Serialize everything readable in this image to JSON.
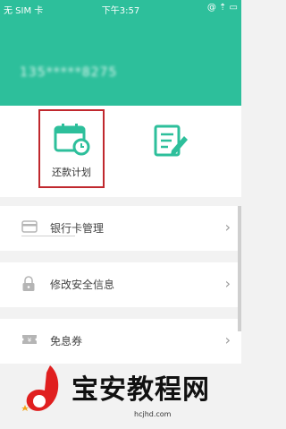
{
  "status_bar": {
    "carrier": "无 SIM 卡",
    "time": "下午3:57",
    "right": "@ ⇡ ▭"
  },
  "account": {
    "masked": "135*****8275"
  },
  "quick_actions": [
    {
      "label": "还款计划",
      "icon": "calendar-clock-icon"
    },
    {
      "label": "",
      "icon": "edit-document-icon"
    }
  ],
  "menu": [
    {
      "label": "银行卡管理",
      "icon": "bank-card-icon"
    },
    {
      "label": "修改安全信息",
      "icon": "lock-icon"
    },
    {
      "label": "免息券",
      "icon": "coupon-icon"
    }
  ],
  "watermark": {
    "title": "宝安教程网",
    "url": "hcjhd.com"
  },
  "colors": {
    "accent": "#2dbf9b",
    "highlight": "#c0282e"
  }
}
